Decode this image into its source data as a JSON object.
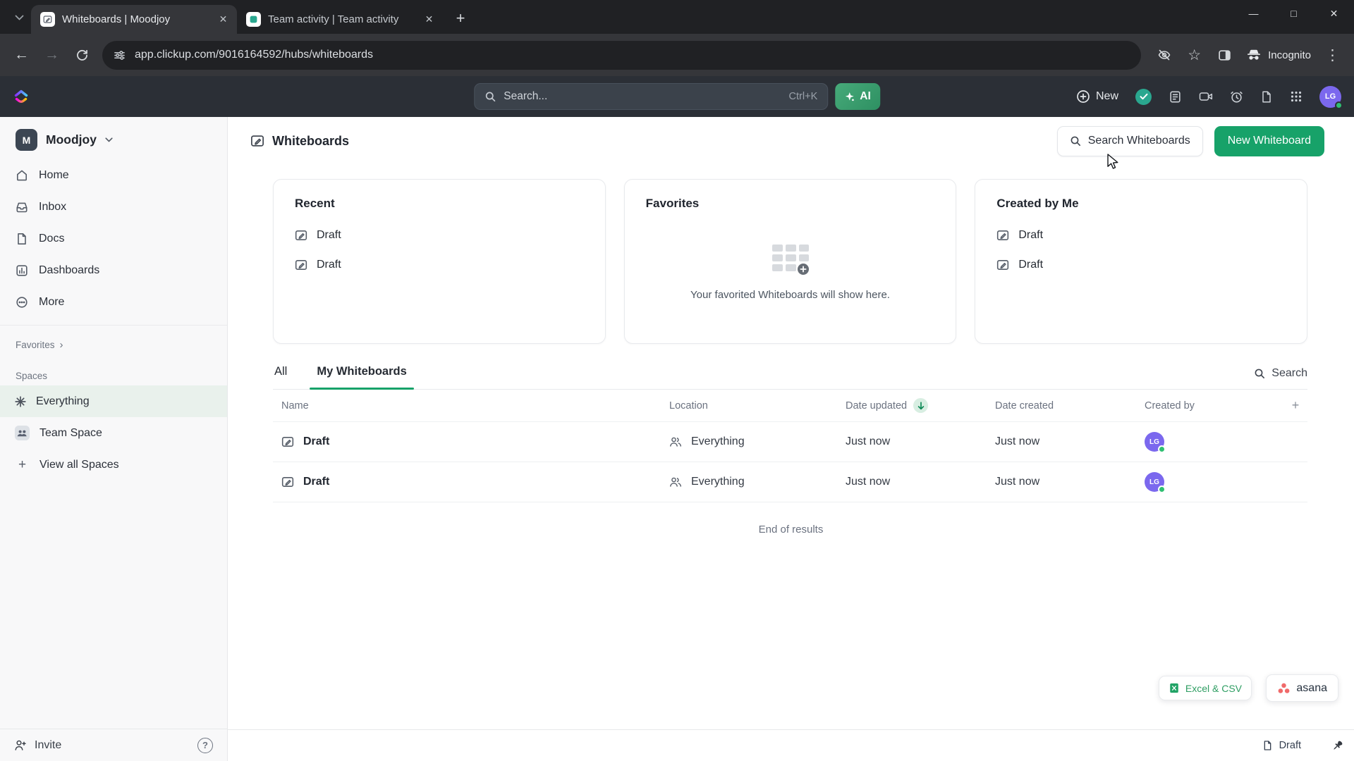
{
  "icons": {
    "close": "✕",
    "minimize": "—",
    "maximize": "□",
    "plus": "+",
    "kebab": "⋮",
    "back": "←",
    "forward": "→",
    "star": "☆",
    "chevron_right": "›",
    "help": "?"
  },
  "browser": {
    "tabs": [
      {
        "title": "Whiteboards | Moodjoy"
      },
      {
        "title": "Team activity | Team activity"
      }
    ],
    "url": "app.clickup.com/9016164592/hubs/whiteboards",
    "incognito_label": "Incognito"
  },
  "topbar": {
    "search_placeholder": "Search...",
    "search_shortcut": "Ctrl+K",
    "ai_label": "AI",
    "new_label": "New",
    "avatar_initials": "LG"
  },
  "sidebar": {
    "workspace": {
      "initial": "M",
      "name": "Moodjoy"
    },
    "nav": [
      {
        "label": "Home"
      },
      {
        "label": "Inbox"
      },
      {
        "label": "Docs"
      },
      {
        "label": "Dashboards"
      },
      {
        "label": "More"
      }
    ],
    "favorites_label": "Favorites",
    "spaces_label": "Spaces",
    "spaces": [
      {
        "label": "Everything"
      },
      {
        "label": "Team Space"
      }
    ],
    "view_all_label": "View all Spaces",
    "invite_label": "Invite"
  },
  "page": {
    "title": "Whiteboards",
    "search_button": "Search Whiteboards",
    "new_button": "New Whiteboard",
    "cards": {
      "recent": {
        "title": "Recent",
        "items": [
          "Draft",
          "Draft"
        ]
      },
      "favorites": {
        "title": "Favorites",
        "empty_text": "Your favorited Whiteboards will show here."
      },
      "created_by_me": {
        "title": "Created by Me",
        "items": [
          "Draft",
          "Draft"
        ]
      }
    },
    "tabs": [
      {
        "label": "All"
      },
      {
        "label": "My Whiteboards"
      }
    ],
    "search_label": "Search",
    "table": {
      "columns": [
        "Name",
        "Location",
        "Date updated",
        "Date created",
        "Created by"
      ],
      "rows": [
        {
          "name": "Draft",
          "location": "Everything",
          "date_updated": "Just now",
          "date_created": "Just now",
          "created_by": "LG"
        },
        {
          "name": "Draft",
          "location": "Everything",
          "date_updated": "Just now",
          "date_created": "Just now",
          "created_by": "LG"
        }
      ]
    },
    "end_of_results": "End of results",
    "export_label": "Excel & CSV",
    "asana_label": "asana"
  },
  "statusbar": {
    "draft_label": "Draft"
  },
  "colors": {
    "accent_green": "#17a269",
    "avatar_purple": "#7b68ee"
  }
}
